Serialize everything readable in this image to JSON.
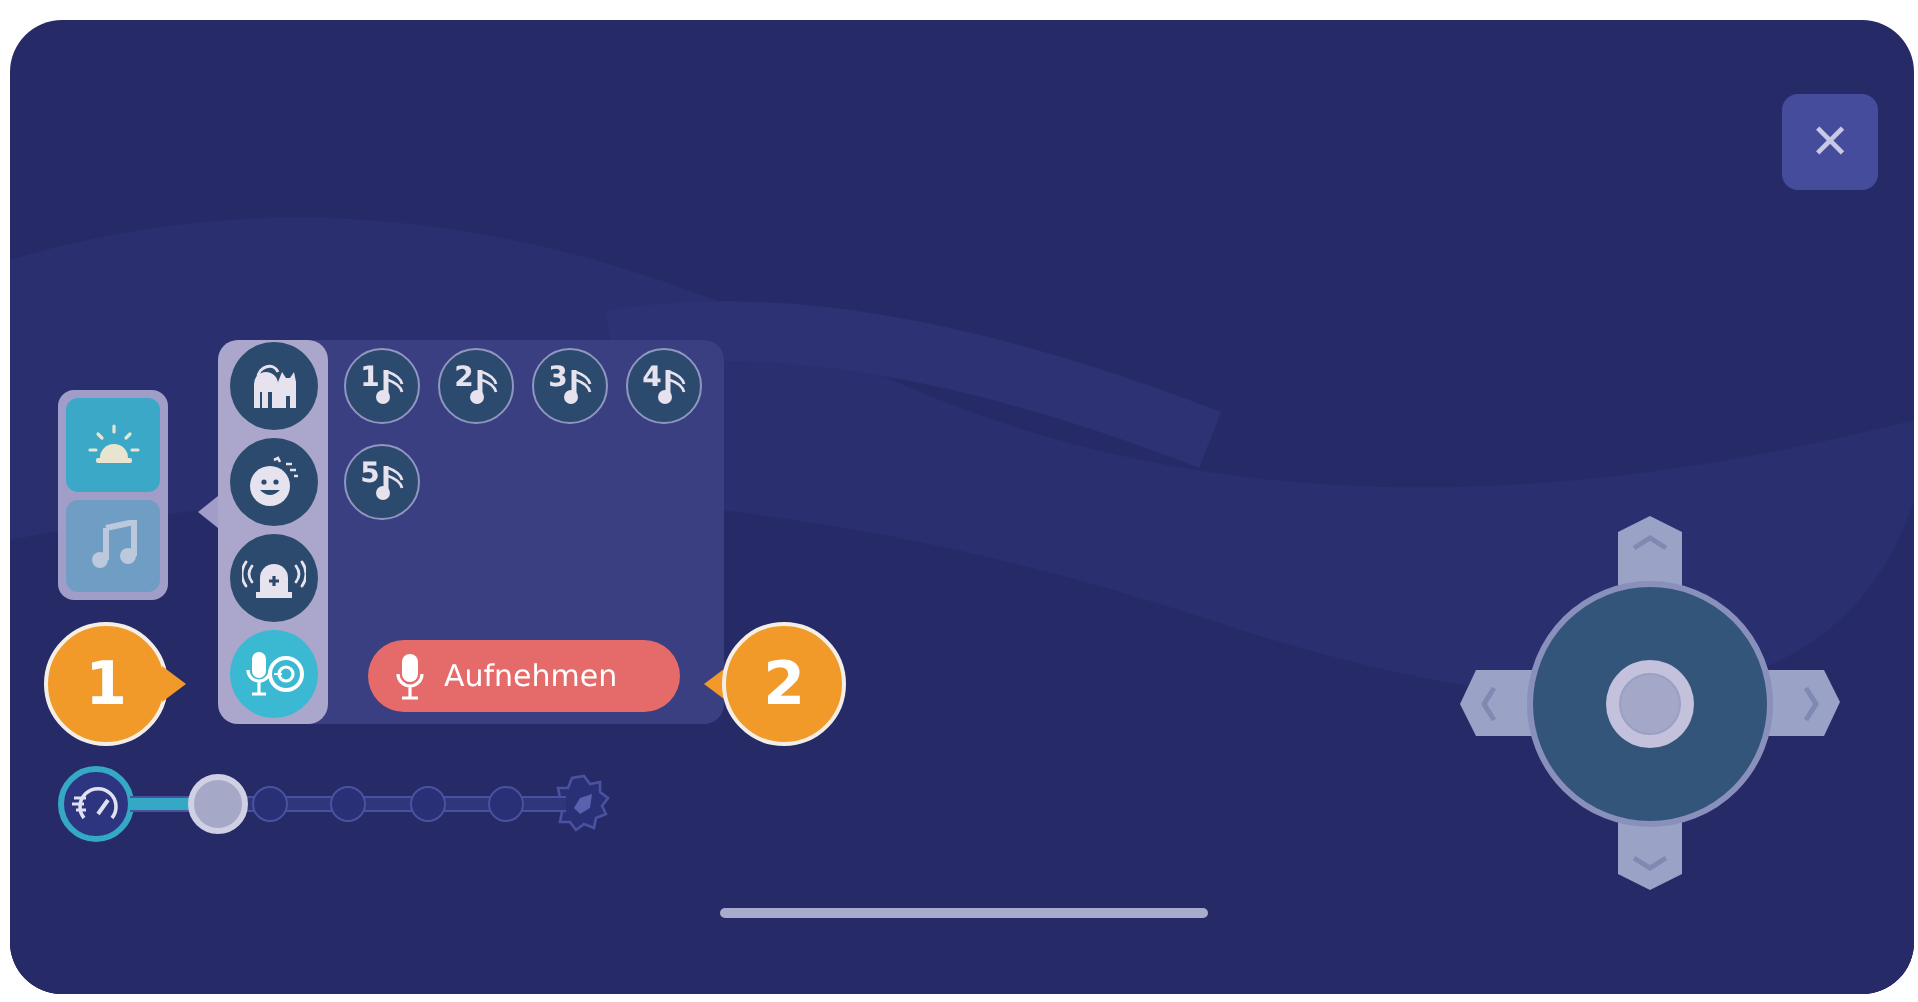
{
  "close_button": {
    "label": "✕"
  },
  "mode_tabs": [
    {
      "kind": "light",
      "selected": false
    },
    {
      "kind": "music",
      "selected": true
    }
  ],
  "categories": [
    {
      "kind": "cat",
      "selected": false
    },
    {
      "kind": "lullaby",
      "selected": false
    },
    {
      "kind": "alarm",
      "selected": false
    },
    {
      "kind": "record",
      "selected": true
    }
  ],
  "tracks": [
    {
      "label": "1"
    },
    {
      "label": "2"
    },
    {
      "label": "3"
    },
    {
      "label": "4"
    },
    {
      "label": "5"
    }
  ],
  "record_button": {
    "label": "Aufnehmen"
  },
  "callouts": [
    {
      "label": "1"
    },
    {
      "label": "2"
    }
  ],
  "speed_slider": {
    "level": 0.2
  }
}
